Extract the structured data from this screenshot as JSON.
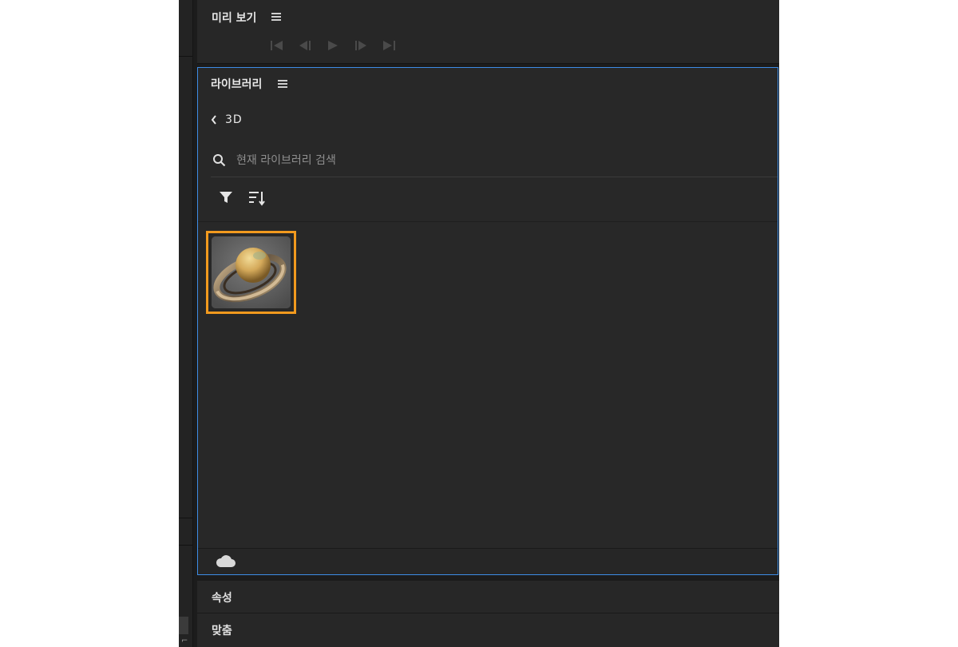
{
  "preview_panel": {
    "title": "미리 보기",
    "transport": [
      "skip-to-start-icon",
      "step-back-icon",
      "play-icon",
      "step-forward-icon",
      "skip-to-end-icon"
    ]
  },
  "library_panel": {
    "title": "라이브러리",
    "breadcrumb": "3D",
    "search_placeholder": "현재 라이브러리 검색",
    "assets": [
      "planet-3d-asset"
    ],
    "accent_color": "#3d8ce6",
    "selection_color": "#f29a1e"
  },
  "properties_panel": {
    "title": "속성"
  },
  "fit_panel": {
    "title": "맞춤"
  }
}
